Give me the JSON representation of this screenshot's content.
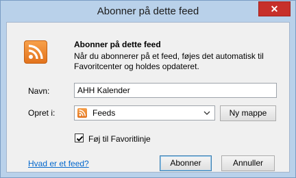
{
  "window": {
    "title": "Abonner på dette feed",
    "close_glyph": "✕"
  },
  "header": {
    "heading": "Abonner på dette feed",
    "description": "Når du abonnerer på et feed, føjes det automatisk til Favoritcenter og holdes opdateret.",
    "icon": "rss-feed-icon"
  },
  "form": {
    "name_label": "Navn:",
    "name_value": "AHH Kalender",
    "create_in_label": "Opret i:",
    "create_in_value": "Feeds",
    "new_folder_button": "Ny mappe",
    "favorites_bar_checkbox_label": "Føj til Favoritlinje",
    "favorites_bar_checked": true
  },
  "footer": {
    "help_link": "Hvad er et feed?",
    "subscribe_button": "Abonner",
    "cancel_button": "Annuller"
  },
  "colors": {
    "titlebar": "#b9d1ea",
    "close_button": "#c7302a",
    "rss_orange": "#e2731d",
    "link": "#0066cc"
  }
}
